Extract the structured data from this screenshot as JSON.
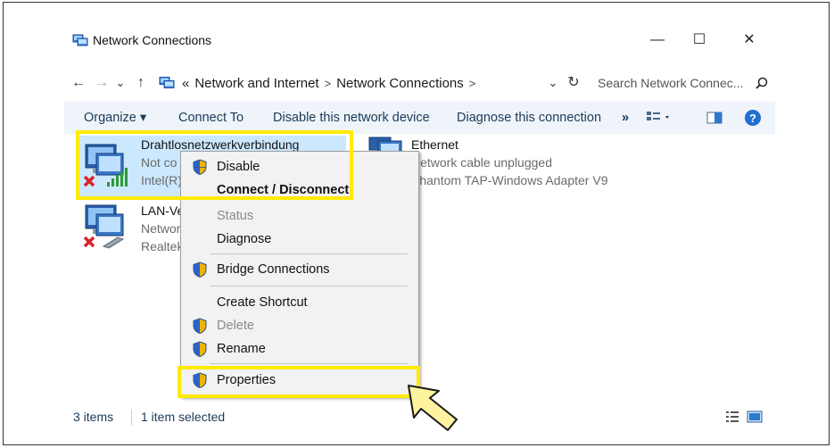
{
  "window": {
    "title": "Network Connections",
    "minimize": "—",
    "maximize": "☐",
    "close": "✕"
  },
  "address": {
    "back": "←",
    "forward": "→",
    "recent": "⌄",
    "up": "↑",
    "overflow": "«",
    "crumb1": "Network and Internet",
    "sep": ">",
    "crumb2": "Network Connections",
    "dropdown": "⌄",
    "refresh": "↻",
    "search_placeholder": "Search Network Connec..."
  },
  "toolbar": {
    "organize": "Organize ▾",
    "connect_to": "Connect To",
    "disable_device": "Disable this network device",
    "diagnose": "Diagnose this connection",
    "more": "»"
  },
  "items": [
    {
      "name": "Drahtlosnetzwerkverbindung",
      "status": "Not co",
      "adapter": "Intel(R)"
    },
    {
      "name": "Ethernet",
      "status": "Network cable unplugged",
      "adapter": "Phantom TAP-Windows Adapter V9"
    },
    {
      "name": "LAN-Ve",
      "status": "Networ",
      "adapter": "Realtek"
    }
  ],
  "context_menu": {
    "disable": "Disable",
    "connect": "Connect / Disconnect",
    "status": "Status",
    "diagnose": "Diagnose",
    "bridge": "Bridge Connections",
    "shortcut": "Create Shortcut",
    "delete": "Delete",
    "rename": "Rename",
    "properties": "Properties"
  },
  "status": {
    "count": "3 items",
    "selected": "1 item selected"
  },
  "colors": {
    "highlight": "#ffeb00",
    "selection": "#cce8ff",
    "toolbar_bg": "#eef4f9",
    "link_text": "#1c3a59"
  }
}
